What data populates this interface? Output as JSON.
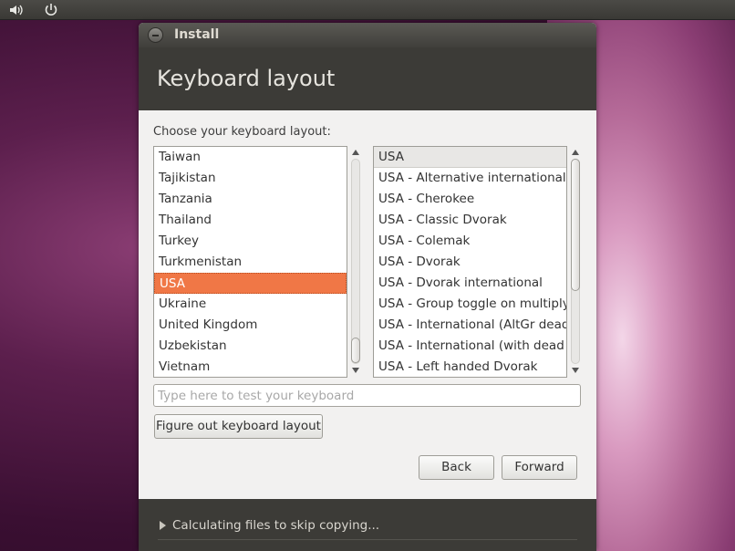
{
  "window": {
    "title": "Install"
  },
  "header": {
    "title": "Keyboard layout"
  },
  "prompt": "Choose your keyboard layout:",
  "countries": [
    "Taiwan",
    "Tajikistan",
    "Tanzania",
    "Thailand",
    "Turkey",
    "Turkmenistan",
    "USA",
    "Ukraine",
    "United Kingdom",
    "Uzbekistan",
    "Vietnam"
  ],
  "selected_country": "USA",
  "variants": [
    "USA",
    "USA - Alternative international (",
    "USA - Cherokee",
    "USA - Classic Dvorak",
    "USA - Colemak",
    "USA - Dvorak",
    "USA - Dvorak international",
    "USA - Group toggle on multiply/",
    "USA - International (AltGr dead",
    "USA - International (with dead k",
    "USA - Left handed Dvorak"
  ],
  "selected_variant": "USA",
  "test_input": {
    "placeholder": "Type here to test your keyboard",
    "value": ""
  },
  "buttons": {
    "figure_out": "Figure out keyboard layout",
    "back": "Back",
    "forward": "Forward"
  },
  "footer": {
    "status": "Calculating files to skip copying..."
  },
  "topbar": {
    "icons": [
      "volume-icon",
      "power-icon"
    ]
  },
  "colors": {
    "selection": "#f07746",
    "header_bg": "#3c3b37",
    "window_bg": "#f2f1f0"
  }
}
